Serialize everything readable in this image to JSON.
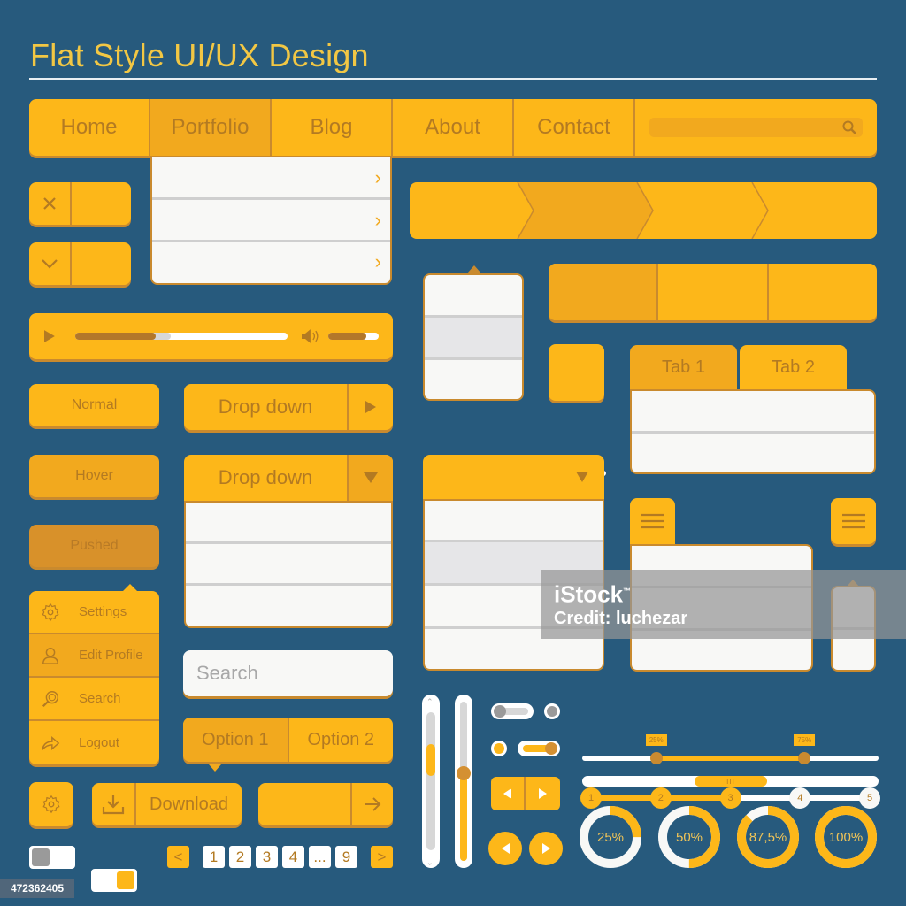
{
  "title": "Flat Style UI/UX Design",
  "colors": {
    "background": "#275a7d",
    "accent": "#fdb719",
    "accent_dark": "#f2a91e",
    "pushed": "#d8912a",
    "edge": "#c98a2e",
    "text": "#b37a22"
  },
  "nav": {
    "items": [
      {
        "label": "Home",
        "active": false
      },
      {
        "label": "Portfolio",
        "active": true
      },
      {
        "label": "Blog",
        "active": false
      },
      {
        "label": "About",
        "active": false
      },
      {
        "label": "Contact",
        "active": false
      }
    ],
    "search_icon": "search-icon",
    "submenu_count": 3
  },
  "icon_buttons": {
    "close_icon": "close-icon",
    "chevron_icon": "chevron-down-icon"
  },
  "player": {
    "progress": 0.38,
    "buffered": 0.45,
    "volume": 0.75,
    "play_icon": "play-icon",
    "volume_icon": "volume-icon"
  },
  "buttons": {
    "normal": "Normal",
    "hover": "Hover",
    "pushed": "Pushed"
  },
  "dropdown_closed": {
    "label": "Drop down"
  },
  "dropdown_open": {
    "label": "Drop down",
    "rows": 3
  },
  "context_menu": {
    "items": [
      {
        "label": "Settings",
        "icon": "gear-icon",
        "active": false
      },
      {
        "label": "Edit Profile",
        "icon": "user-icon",
        "active": true
      },
      {
        "label": "Search",
        "icon": "search-icon",
        "active": false
      },
      {
        "label": "Logout",
        "icon": "share-icon",
        "active": false
      }
    ]
  },
  "search": {
    "placeholder": "Search"
  },
  "segmented": {
    "options": [
      "Option 1",
      "Option 2"
    ],
    "selected": 0
  },
  "download": {
    "label": "Download"
  },
  "toggles": [
    {
      "on": false
    },
    {
      "on": true
    }
  ],
  "pagination": {
    "pages": [
      "1",
      "2",
      "3",
      "4",
      "...",
      "9"
    ],
    "prev": "<",
    "next": ">"
  },
  "tabs": [
    {
      "label": "Tab 1",
      "active": true
    },
    {
      "label": "Tab 2",
      "active": false
    }
  ],
  "slider": {
    "value": 0.4
  },
  "range_slider": {
    "low_label": "25%",
    "high_label": "75%",
    "low": 0.25,
    "high": 0.75
  },
  "stepper": {
    "steps": [
      "1",
      "2",
      "3",
      "4",
      "5"
    ],
    "current": 3
  },
  "scrollbar": {
    "grip": "III"
  },
  "donuts": [
    {
      "label": "25%",
      "value": 0.25
    },
    {
      "label": "50%",
      "value": 0.5
    },
    {
      "label": "87,5%",
      "value": 0.875
    },
    {
      "label": "100%",
      "value": 1.0
    }
  ],
  "vertical_sliders": {
    "scroll_position": 0.3,
    "slider_value": 0.45
  },
  "mini_toggles": [
    {
      "on": false
    },
    {
      "on": true
    }
  ],
  "watermark": {
    "brand": "iStock",
    "trademark": "™",
    "credit": "Credit: luchezar"
  },
  "stock_id": "472362405"
}
